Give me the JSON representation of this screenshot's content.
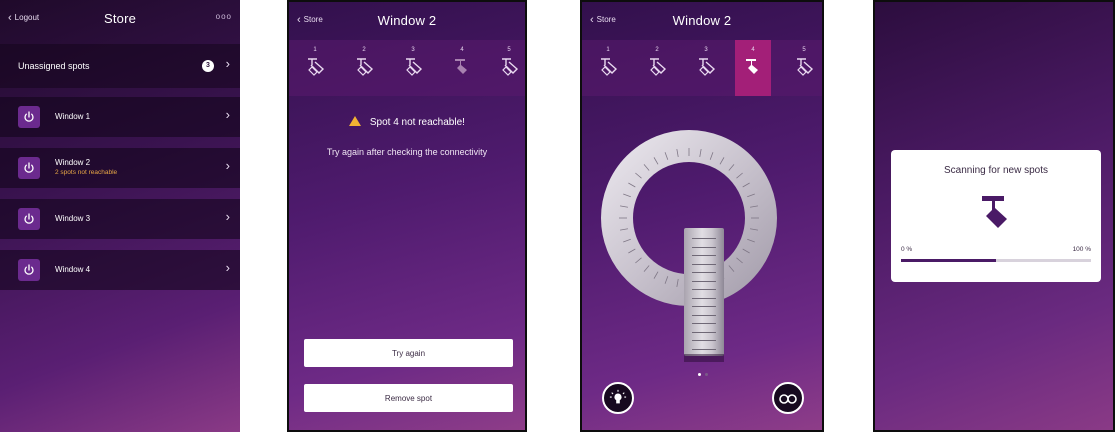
{
  "screens": {
    "store": {
      "back_label": "Logout",
      "title": "Store",
      "more_label": "ooo",
      "unassigned": {
        "label": "Unassigned spots",
        "count": "3"
      },
      "windows": [
        {
          "name": "Window 1",
          "status": ""
        },
        {
          "name": "Window 2",
          "status": "2 spots not reachable"
        },
        {
          "name": "Window 3",
          "status": ""
        },
        {
          "name": "Window 4",
          "status": ""
        }
      ]
    },
    "window_error": {
      "back_label": "Store",
      "title": "Window 2",
      "spots": [
        "1",
        "2",
        "3",
        "4",
        "5"
      ],
      "active_spot": 4,
      "warning": "Spot 4 not reachable!",
      "help": "Try again after checking the connectivity",
      "try_again_label": "Try again",
      "remove_label": "Remove spot"
    },
    "window_control": {
      "back_label": "Store",
      "title": "Window 2",
      "spots": [
        "1",
        "2",
        "3",
        "4",
        "5"
      ],
      "active_spot": 4,
      "page_count": 2,
      "current_page": 1
    },
    "scan": {
      "title": "Scanning for new spots",
      "min_label": "0 %",
      "max_label": "100 %",
      "progress": 0.5
    }
  },
  "colors": {
    "accent_magenta": "#a31f78",
    "power_button": "#6b2a8e",
    "warning": "#f1b233",
    "status_orange": "#e7a645"
  },
  "icons": [
    "chevron-left-icon",
    "chevron-right-icon",
    "power-icon",
    "spot-light-icon",
    "warning-icon",
    "bulb-icon",
    "binoculars-icon"
  ]
}
